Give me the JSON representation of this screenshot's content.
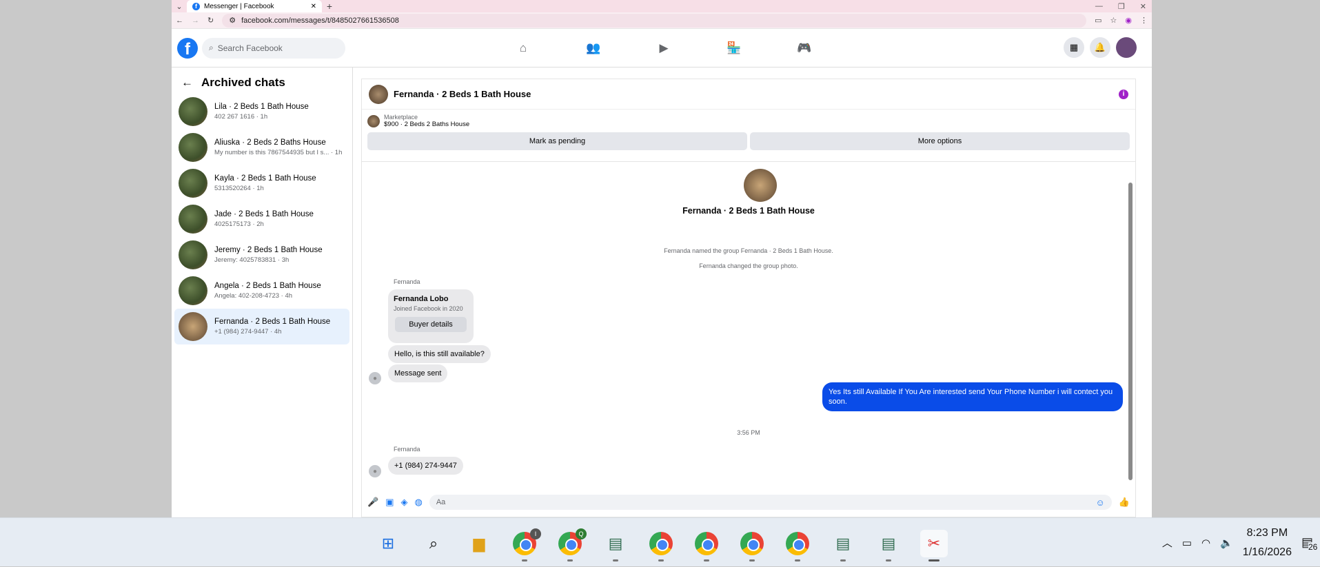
{
  "browser": {
    "tab_title": "Messenger | Facebook",
    "url": "facebook.com/messages/t/8485027661536508"
  },
  "facebook": {
    "search_placeholder": "Search Facebook"
  },
  "sidebar": {
    "title": "Archived chats",
    "chats": [
      {
        "name": "Lila · 2 Beds 1 Bath House",
        "sub": "402 267 1616 · 1h"
      },
      {
        "name": "Aliuska · 2 Beds 2 Baths House",
        "sub": "My number is this 7867544935 but I s... · 1h"
      },
      {
        "name": "Kayla · 2 Beds 1 Bath House",
        "sub": "5313520264 · 1h"
      },
      {
        "name": "Jade · 2 Beds 1 Bath House",
        "sub": "4025175173 · 2h"
      },
      {
        "name": "Jeremy · 2 Beds 1 Bath House",
        "sub": "Jeremy: 4025783831 · 3h"
      },
      {
        "name": "Angela · 2 Beds 1 Bath House",
        "sub": "Angela: 402-208-4723 · 4h"
      },
      {
        "name": "Fernanda · 2 Beds 1 Bath House",
        "sub": "+1 (984) 274-9447 · 4h"
      }
    ]
  },
  "conversation": {
    "title": "Fernanda · 2 Beds 1 Bath House",
    "marketplace_label": "Marketplace",
    "listing": "$900 · 2 Beds 2 Baths House",
    "mark_pending": "Mark as pending",
    "more_options": "More options",
    "header_name": "Fernanda · 2 Beds 1 Bath House",
    "sys1": "Fernanda named the group Fernanda · 2 Beds 1 Bath House.",
    "sys2": "Fernanda changed the group photo.",
    "sender": "Fernanda",
    "card_name": "Fernanda Lobo",
    "card_joined": "Joined Facebook in 2020",
    "buyer_details": "Buyer details",
    "msg1": "Hello, is this still available?",
    "msg2": "Message sent",
    "outgoing": "Yes Its still Available If You Are interested send Your Phone Number i will contect you soon.",
    "time": "3:56 PM",
    "sender2": "Fernanda",
    "msg3": "+1 (984) 274-9447",
    "composer_placeholder": "Aa"
  },
  "taskbar": {
    "time": "8:23 PM",
    "date": "1/16/2026",
    "notification_count": "26",
    "chrome_badges": [
      "I",
      "Q"
    ]
  },
  "colors": {
    "accent": "#1877f2",
    "outgoing_bubble": "#0a4ce8",
    "info": "#a020c8"
  }
}
